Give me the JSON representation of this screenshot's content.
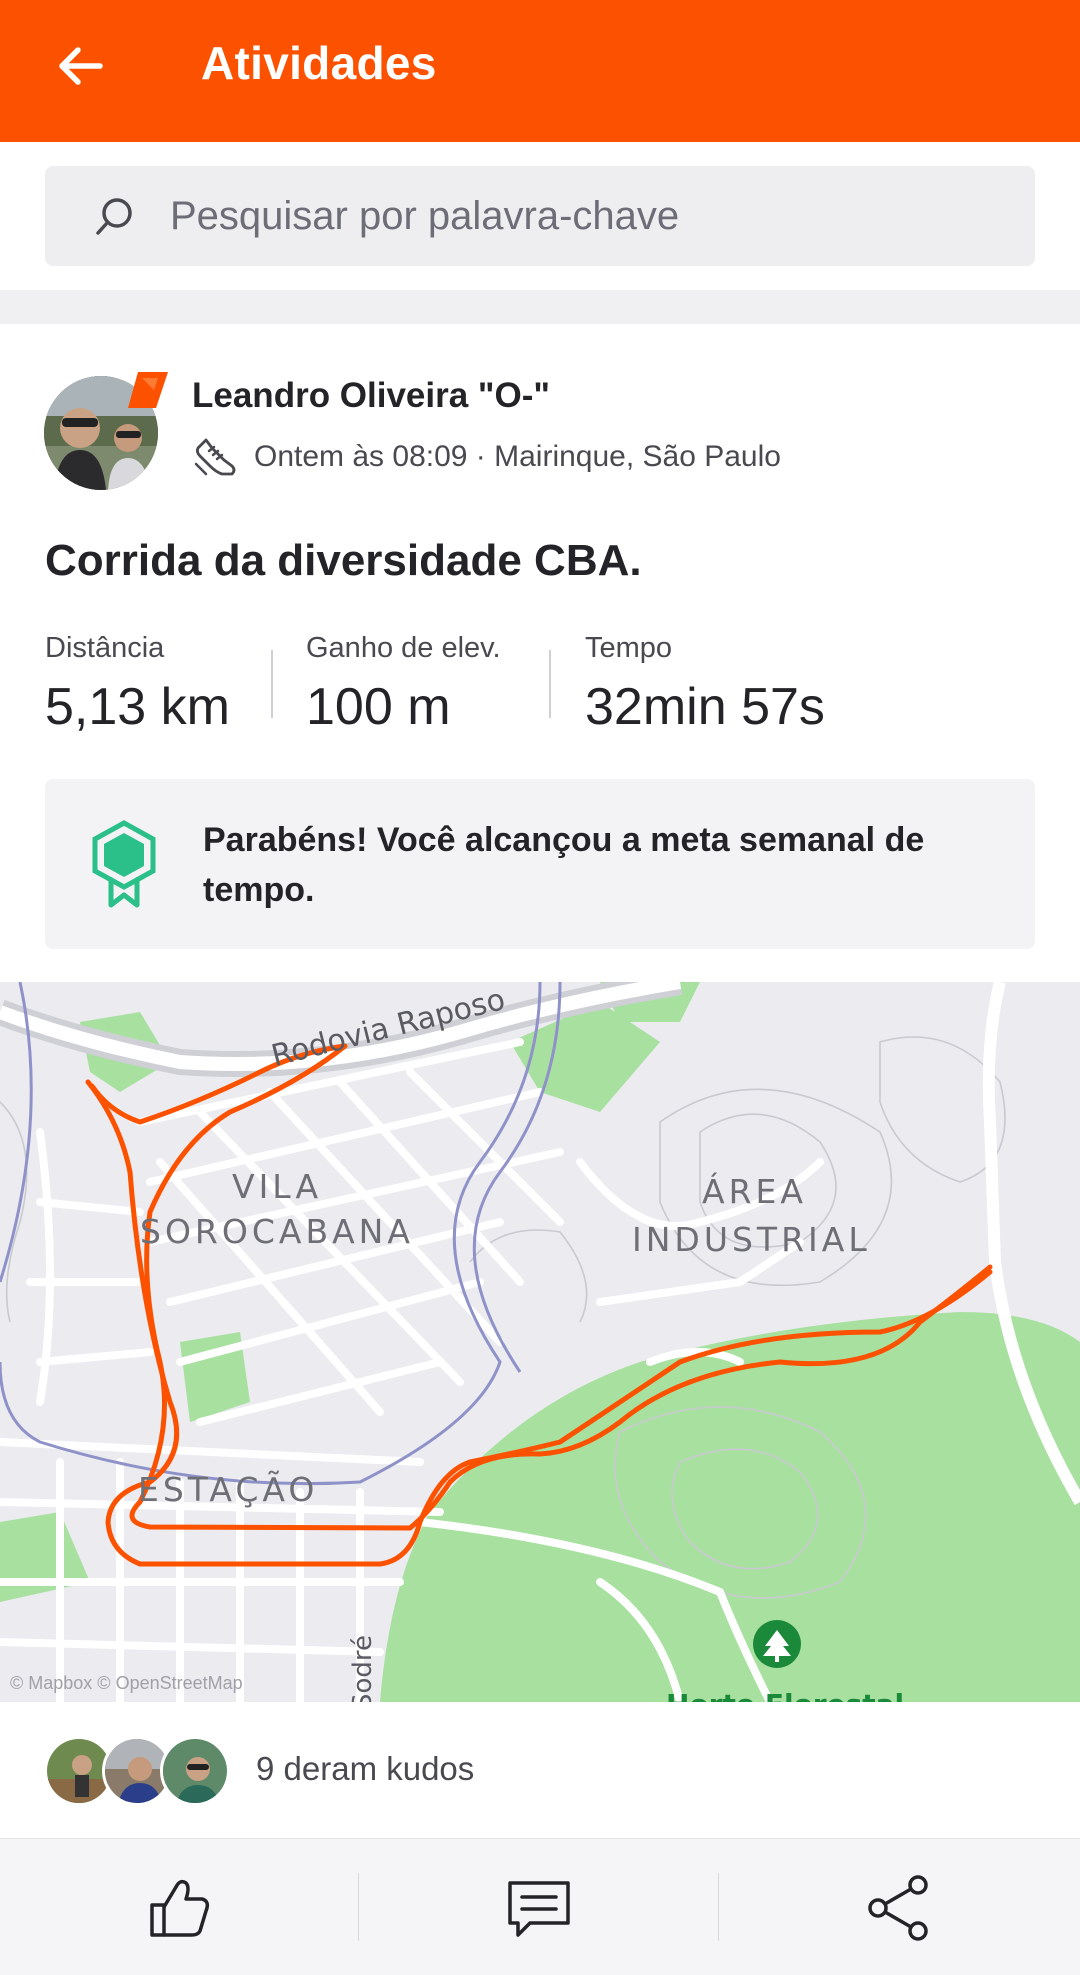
{
  "header": {
    "title": "Atividades",
    "back_icon": "arrow-left-icon"
  },
  "search": {
    "placeholder": "Pesquisar por palavra-chave",
    "value": "",
    "icon": "search-icon"
  },
  "activity": {
    "athlete_name": "Leandro Oliveira \"O-\"",
    "meta": "Ontem às 08:09 · Mairinque, São Paulo",
    "sport_icon": "running-shoe-icon",
    "title": "Corrida da diversidade CBA.",
    "stats": [
      {
        "label": "Distância",
        "value": "5,13 km"
      },
      {
        "label": "Ganho de elev.",
        "value": "100 m"
      },
      {
        "label": "Tempo",
        "value": "32min 57s"
      }
    ],
    "goal_message": "Parabéns! Você alcançou a meta semanal de tempo."
  },
  "map": {
    "labels": {
      "road": "Rodovia Raposo",
      "vila_line1": "VILA",
      "vila_line2": "SOROCABANA",
      "area_line1": "ÁREA",
      "area_line2": "INDUSTRIAL",
      "estacao": "ESTAÇÃO",
      "sodre": "Sodré",
      "horto": "Horto Florestal"
    },
    "attribution": "© Mapbox © OpenStreetMap",
    "route_color": "#fc5200"
  },
  "kudos": {
    "text": "9 deram kudos",
    "count": 9
  },
  "actions": {
    "kudos_icon": "thumbs-up-icon",
    "comment_icon": "comment-icon",
    "share_icon": "share-icon"
  },
  "colors": {
    "brand": "#fc5200",
    "goal_badge": "#2bbf8a"
  }
}
